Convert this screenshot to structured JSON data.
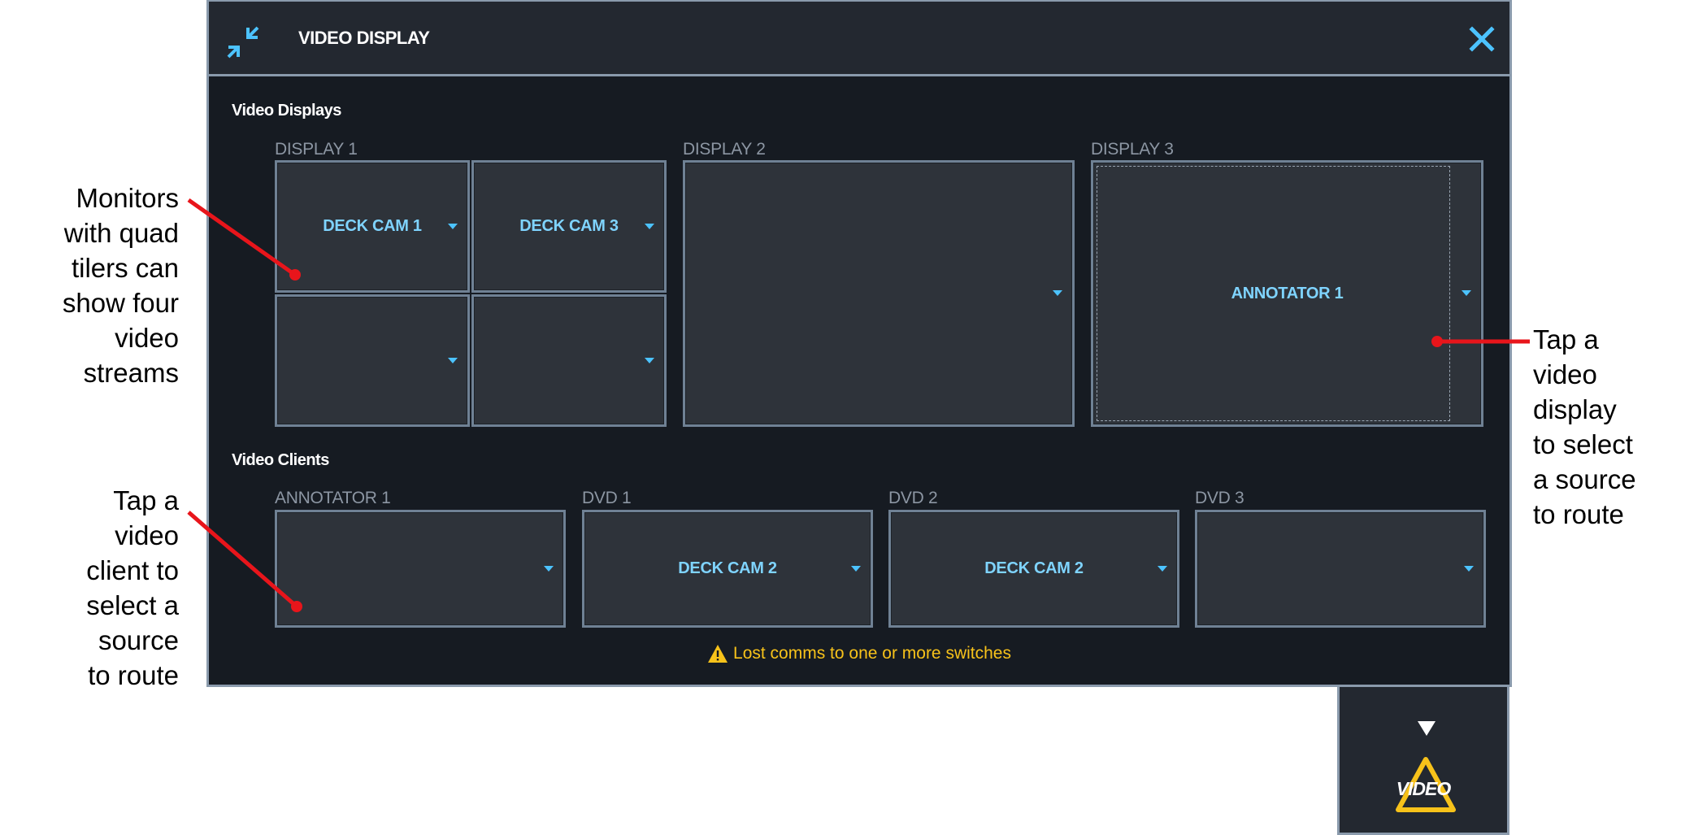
{
  "panel": {
    "title": "VIDEO DISPLAY",
    "video_displays_label": "Video Displays",
    "video_clients_label": "Video Clients",
    "displays": [
      {
        "label": "DISPLAY 1",
        "tiles": [
          "DECK CAM 1",
          "DECK CAM 3",
          "",
          ""
        ]
      },
      {
        "label": "DISPLAY 2",
        "tiles": [
          ""
        ]
      },
      {
        "label": "DISPLAY 3",
        "tiles": [
          "ANNOTATOR 1"
        ]
      }
    ],
    "clients": [
      {
        "label": "ANNOTATOR 1",
        "source": ""
      },
      {
        "label": "DVD 1",
        "source": "DECK CAM 2"
      },
      {
        "label": "DVD 2",
        "source": "DECK CAM 2"
      },
      {
        "label": "DVD 3",
        "source": ""
      }
    ],
    "warning": "Lost comms to one or more switches"
  },
  "video_button": {
    "label": "VIDEO"
  },
  "callouts": {
    "quad": "Monitors\nwith quad\ntilers can\nshow four\nvideo\nstreams",
    "client": "Tap a\nvideo\nclient to\nselect a\nsource\nto route",
    "display": "Tap a\nvideo\ndisplay\nto select\na source\nto route"
  },
  "colors": {
    "panel_bg": "#161b22",
    "tile_bg": "#2e333a",
    "source_text": "#7fd4ff",
    "warning": "#f7c21a",
    "callout_line": "#e8151b"
  },
  "icons": [
    "collapse-icon",
    "close-icon",
    "warning-icon",
    "chevron-down-icon"
  ]
}
